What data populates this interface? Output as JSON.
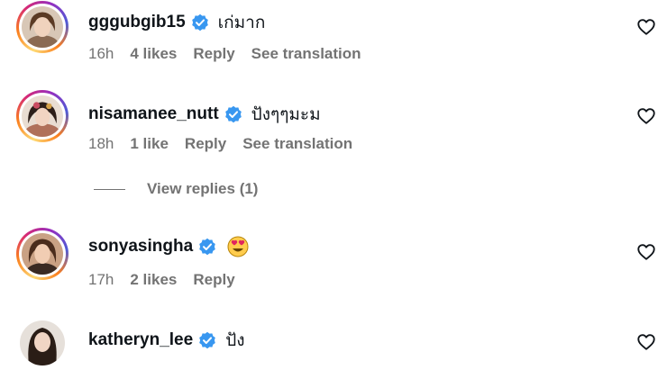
{
  "comments": [
    {
      "username": "gggubgib15",
      "text": "เก่มาก",
      "time": "16h",
      "likes": "4 likes",
      "reply": "Reply",
      "translate": "See translation"
    },
    {
      "username": "nisamanee_nutt",
      "text": "ปังๆๆมะม",
      "time": "18h",
      "likes": "1 like",
      "reply": "Reply",
      "translate": "See translation"
    },
    {
      "username": "sonyasingha",
      "emoji": "heart-eyes-emoji",
      "time": "17h",
      "likes": "2 likes",
      "reply": "Reply"
    },
    {
      "username": "katheryn_lee",
      "text": "ปัง"
    }
  ],
  "view_replies": "View replies (1)",
  "colors": {
    "verified": "#3897f0",
    "meta": "#737373",
    "text": "#0f1419"
  }
}
